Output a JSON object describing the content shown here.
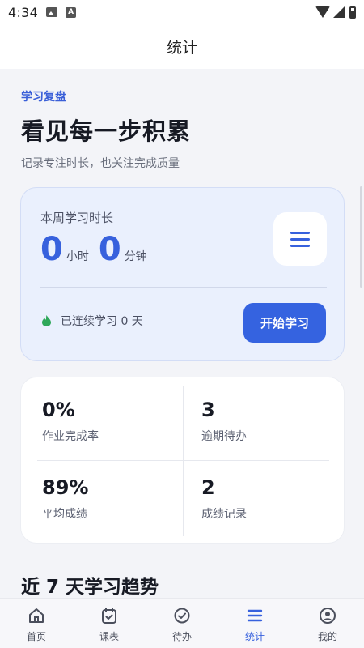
{
  "status_bar": {
    "time": "4:34"
  },
  "app_bar": {
    "title": "统计"
  },
  "hero": {
    "eyebrow": "学习复盘",
    "title": "看见每一步积累",
    "subtitle": "记录专注时长，也关注完成质量"
  },
  "weekly": {
    "label": "本周学习时长",
    "hours": "0",
    "hours_unit": "小时",
    "minutes": "0",
    "minutes_unit": "分钟",
    "streak_text": "已连续学习 0 天",
    "start_button": "开始学习"
  },
  "stats": [
    {
      "value": "0%",
      "label": "作业完成率"
    },
    {
      "value": "3",
      "label": "逾期待办"
    },
    {
      "value": "89%",
      "label": "平均成绩"
    },
    {
      "value": "2",
      "label": "成绩记录"
    }
  ],
  "trend": {
    "title": "近 7 天学习趋势"
  },
  "bottom_nav": {
    "active": "统计",
    "items": [
      {
        "label": "首页",
        "icon": "home-icon"
      },
      {
        "label": "课表",
        "icon": "calendar-icon"
      },
      {
        "label": "待办",
        "icon": "check-circle-icon"
      },
      {
        "label": "统计",
        "icon": "menu-lines-icon"
      },
      {
        "label": "我的",
        "icon": "profile-icon"
      }
    ]
  },
  "colors": {
    "accent": "#3761dd",
    "card_bg": "#eaf0fd",
    "page_bg": "#f3f4f8",
    "streak_green": "#2fa85a"
  }
}
